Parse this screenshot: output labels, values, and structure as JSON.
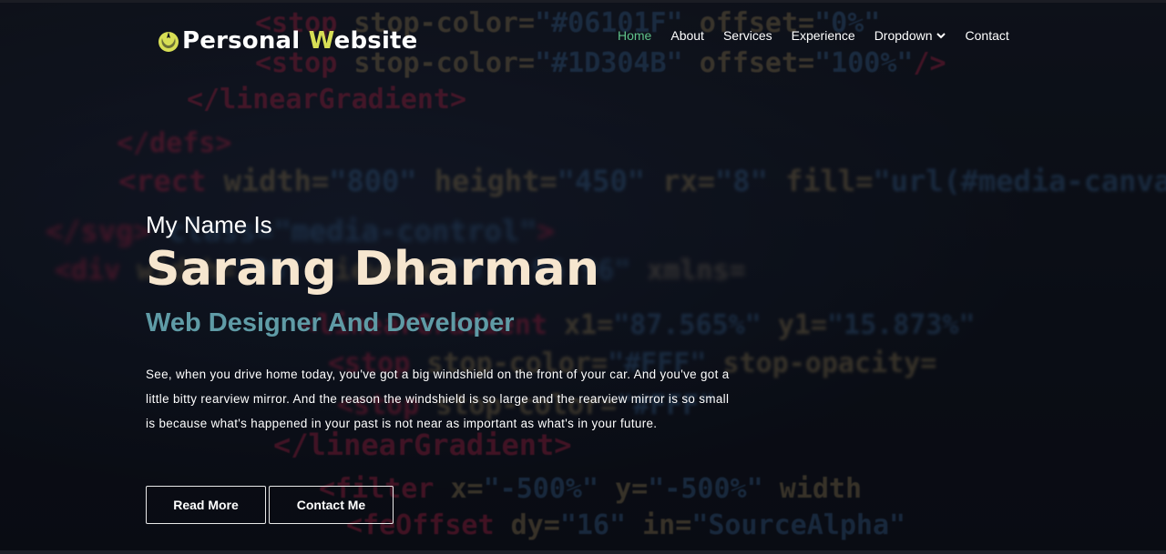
{
  "brand": {
    "prefix": "Personal ",
    "accent_letter": "W",
    "suffix": "ebsite",
    "logo_icon": "rebel-alliance-icon",
    "accent_color": "#d7de55"
  },
  "nav": {
    "items": [
      {
        "label": "Home",
        "active": true
      },
      {
        "label": "About"
      },
      {
        "label": "Services"
      },
      {
        "label": "Experience"
      },
      {
        "label": "Dropdown",
        "icon": "chevron-down-icon"
      },
      {
        "label": "Contact"
      }
    ],
    "active_color": "#5fc28a"
  },
  "hero": {
    "intro": "My Name Is",
    "name": "Sarang Dharman",
    "role": "Web Designer And Developer",
    "description": "See, when you drive home today, you've got a big windshield on the front of your car. And you've got a little bitty rearview mirror. And the reason the windshield is so large and the rearview mirror is so small is because what's happened in your past is not near as important as what's in your future.",
    "name_color": "#f6e6cf",
    "role_color": "#5f9ba6"
  },
  "buttons": {
    "read_more": "Read More",
    "contact_me": "Contact Me"
  }
}
